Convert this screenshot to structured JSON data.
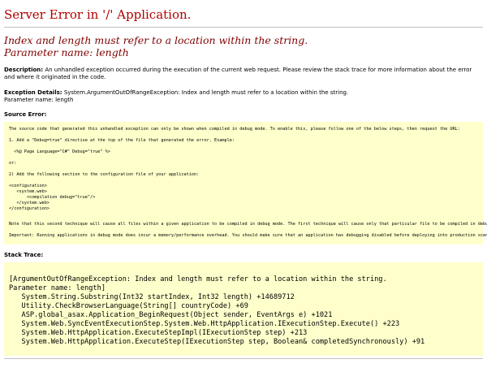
{
  "page_title": "Server Error in '/' Application.",
  "error_message": "Index and length must refer to a location within the string.",
  "param_line": "Parameter name: length",
  "description": {
    "label": "Description:",
    "text": "An unhandled exception occurred during the execution of the current web request. Please review the stack trace for more information about the error and where it originated in the code."
  },
  "exception_details": {
    "label": "Exception Details:",
    "text": "System.ArgumentOutOfRangeException: Index and length must refer to a location within the string.",
    "param": "Parameter name: length"
  },
  "source_error": {
    "heading": "Source Error:",
    "lines": [
      "The source code that generated this unhandled exception can only be shown when compiled in debug mode. To enable this, please follow one of the below steps, then request the URL:",
      "",
      "1. Add a \"Debug=true\" directive at the top of the file that generated the error. Example:",
      "",
      "  <%@ Page Language=\"C#\" Debug=\"true\" %>",
      "",
      "or:",
      "",
      "2) Add the following section to the configuration file of your application:",
      "",
      "<configuration>",
      "   <system.web>",
      "       <compilation debug=\"true\"/>",
      "   </system.web>",
      "</configuration>",
      "",
      "Note that this second technique will cause all files within a given application to be compiled in debug mode. The first technique will cause only that particular file to be compiled in debug mode.",
      "",
      "Important: Running applications in debug mode does incur a memory/performance overhead. You should make sure that an application has debugging disabled before deploying into production scenario."
    ]
  },
  "stack_trace": {
    "heading": "Stack Trace:",
    "lines": [
      "[ArgumentOutOfRangeException: Index and length must refer to a location within the string.",
      "Parameter name: length]",
      "   System.String.Substring(Int32 startIndex, Int32 length) +14689712",
      "   Utility.CheckBrowserLanguage(String[] countryCode) +69",
      "   ASP.global_asax.Application_BeginRequest(Object sender, EventArgs e) +1021",
      "   System.Web.SyncEventExecutionStep.System.Web.HttpApplication.IExecutionStep.Execute() +223",
      "   System.Web.HttpApplication.ExecuteStepImpl(IExecutionStep step) +213",
      "   System.Web.HttpApplication.ExecuteStep(IExecutionStep step, Boolean& completedSynchronously) +91"
    ]
  }
}
